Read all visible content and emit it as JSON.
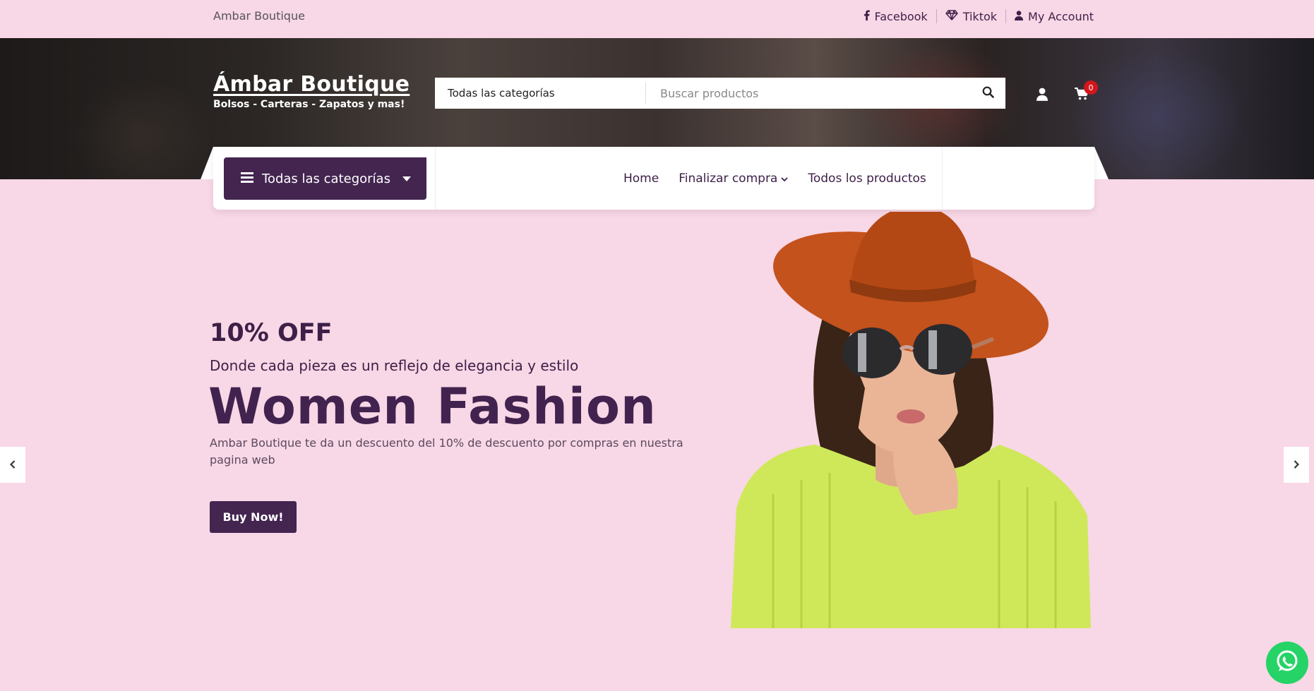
{
  "topbar": {
    "brand": "Ambar Boutique",
    "links": [
      {
        "label": "Facebook",
        "icon": "facebook-icon"
      },
      {
        "label": "Tiktok",
        "icon": "diamond-icon"
      },
      {
        "label": "My Account",
        "icon": "user-icon"
      }
    ]
  },
  "header": {
    "logo_title": "Ámbar Boutique",
    "logo_subtitle": "Bolsos - Carteras - Zapatos y mas!",
    "search": {
      "category": "Todas las categorías",
      "placeholder": "Buscar productos"
    },
    "cart_count": "0"
  },
  "nav": {
    "categories_button": "Todas las categorías",
    "items": [
      {
        "label": "Home"
      },
      {
        "label": "Finalizar compra"
      },
      {
        "label": "Todos los productos"
      }
    ]
  },
  "hero": {
    "discount": "10% OFF",
    "tagline": "Donde cada pieza es un reflejo de elegancia y estilo",
    "title": "Women Fashion",
    "description": "Ambar Boutique te da un descuento del 10% de descuento por compras en nuestra pagina web",
    "cta": "Buy Now!"
  },
  "colors": {
    "background": "#f8d7e6",
    "brand_purple": "#432550",
    "cart_badge": "#d3161d",
    "whatsapp": "#25d366"
  }
}
